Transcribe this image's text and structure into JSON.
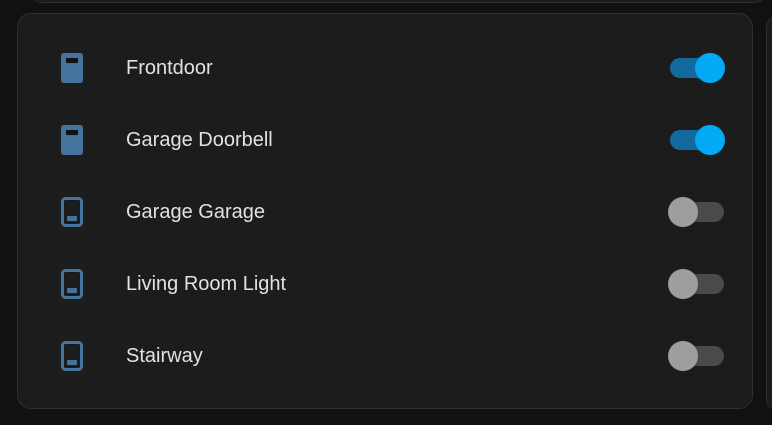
{
  "colors": {
    "background": "#111111",
    "card": "#1c1c1c",
    "icon": "#44739e",
    "toggle_on_thumb": "#03a9f4",
    "toggle_on_track": "#136a9f",
    "toggle_off_thumb": "#9e9e9e",
    "toggle_off_track": "#4a4a4a",
    "text": "#e2e2e2"
  },
  "entities": [
    {
      "name": "Frontdoor",
      "icon": "doorbell-filled-icon",
      "state": "on"
    },
    {
      "name": "Garage Doorbell",
      "icon": "doorbell-filled-icon",
      "state": "on"
    },
    {
      "name": "Garage Garage",
      "icon": "light-switch-outline-icon",
      "state": "off"
    },
    {
      "name": "Living Room Light",
      "icon": "light-switch-outline-icon",
      "state": "off"
    },
    {
      "name": "Stairway",
      "icon": "light-switch-outline-icon",
      "state": "off"
    }
  ]
}
